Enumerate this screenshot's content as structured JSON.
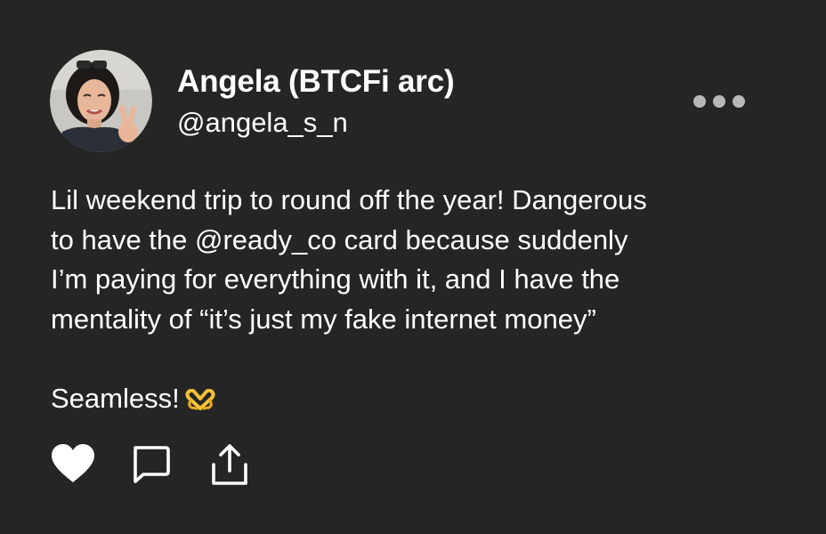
{
  "post": {
    "author": {
      "display_name": "Angela (BTCFi arc)",
      "handle": "@angela_s_n",
      "avatar": "profile-photo"
    },
    "body_lines": [
      "Lil weekend trip to round off the year! Dangerous",
      "to have the @ready_co card because suddenly",
      "I’m paying for everything with it, and I have the",
      "mentality of “it’s just my fake internet money”"
    ],
    "closing_line": "Seamless!",
    "closing_emoji": "heart-hands-emoji",
    "menu_icon": "more-horizontal-icon",
    "actions": [
      "heart-icon",
      "comment-icon",
      "share-icon"
    ]
  },
  "colors": {
    "background": "#252525",
    "text": "#ffffff",
    "menu_dots": "#b8b8b8",
    "emoji": "#f5c237"
  }
}
